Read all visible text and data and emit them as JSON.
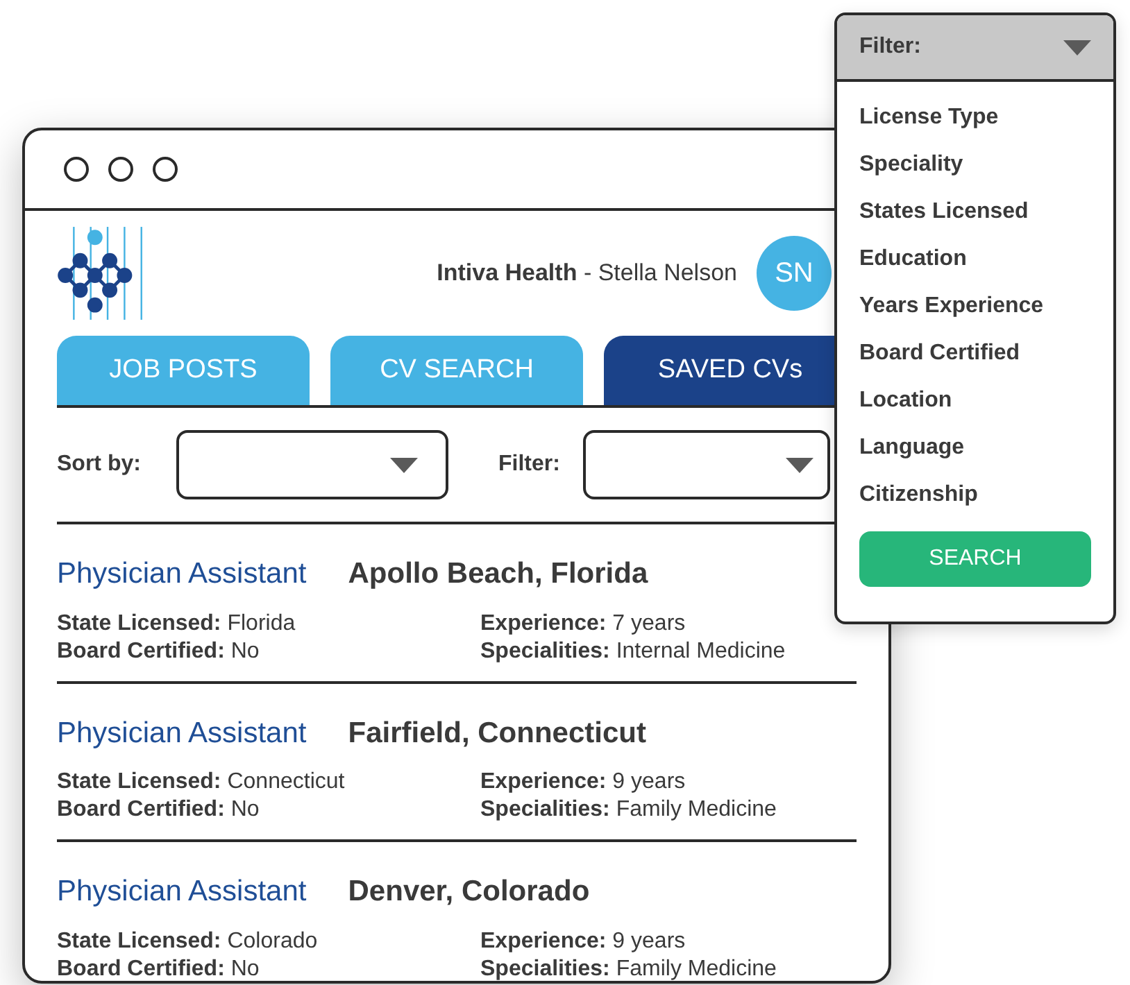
{
  "header": {
    "company": "Intiva Health",
    "separator": " - ",
    "user": "Stella Nelson",
    "avatar_initials": "SN"
  },
  "tabs": [
    {
      "label": "JOB POSTS",
      "selected": false
    },
    {
      "label": "CV SEARCH",
      "selected": false
    },
    {
      "label": "SAVED CVs",
      "selected": true
    }
  ],
  "sort": {
    "label": "Sort by:"
  },
  "filter": {
    "label": "Filter:"
  },
  "results": [
    {
      "title": "Physician Assistant",
      "location": "Apollo Beach, Florida",
      "fields": [
        {
          "label": "State Licensed:",
          "value": "Florida"
        },
        {
          "label": "Experience:",
          "value": "7 years"
        },
        {
          "label": "Board Certified:",
          "value": "No"
        },
        {
          "label": "Specialities:",
          "value": "Internal Medicine"
        }
      ]
    },
    {
      "title": "Physician Assistant",
      "location": "Fairfield, Connecticut",
      "fields": [
        {
          "label": "State Licensed:",
          "value": "Connecticut"
        },
        {
          "label": "Experience:",
          "value": "9 years"
        },
        {
          "label": "Board Certified:",
          "value": "No"
        },
        {
          "label": "Specialities:",
          "value": "Family Medicine"
        }
      ]
    },
    {
      "title": "Physician Assistant",
      "location": "Denver, Colorado",
      "fields": [
        {
          "label": "State Licensed:",
          "value": "Colorado"
        },
        {
          "label": "Experience:",
          "value": "9 years"
        },
        {
          "label": "Board Certified:",
          "value": "No"
        },
        {
          "label": "Specialities:",
          "value": "Family Medicine"
        }
      ]
    }
  ],
  "filter_popup": {
    "title": "Filter:",
    "options": [
      "License Type",
      "Speciality",
      "States Licensed",
      "Education",
      "Years Experience",
      "Board Certified",
      "Location",
      "Language",
      "Citizenship"
    ],
    "button": "SEARCH"
  }
}
